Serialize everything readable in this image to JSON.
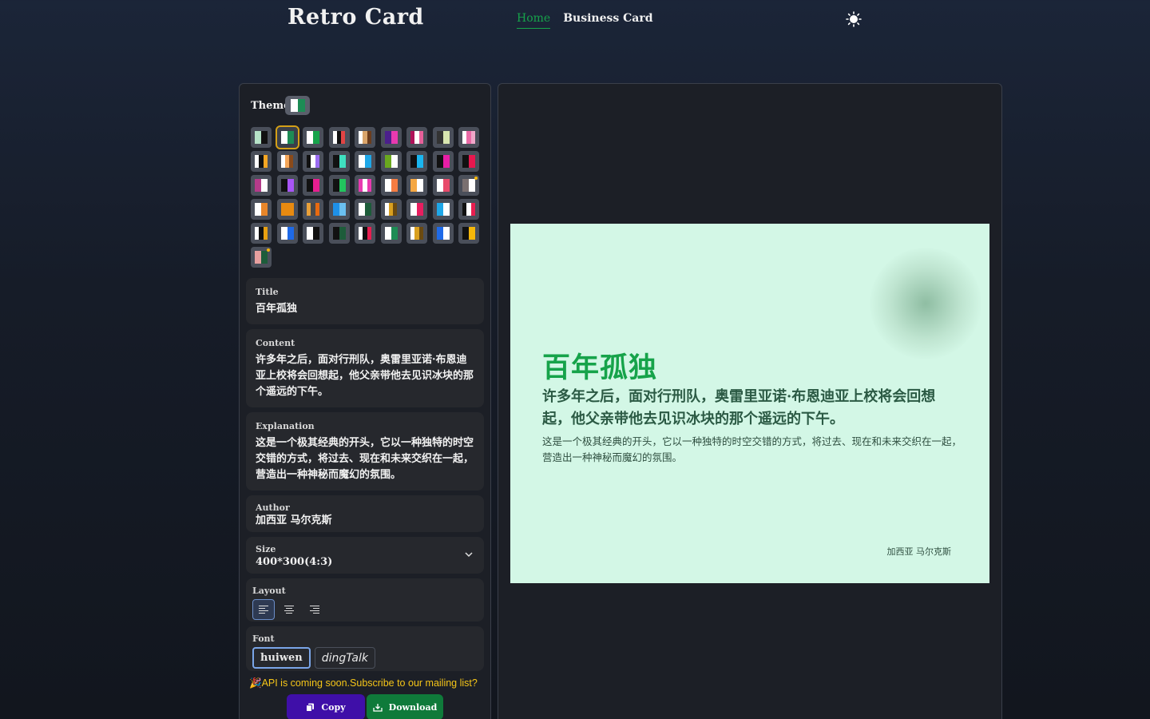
{
  "header": {
    "brand": "Retro Card",
    "nav": [
      {
        "label": "Home",
        "active": true
      },
      {
        "label": "Business Card",
        "active": false
      }
    ]
  },
  "theme": {
    "label": "Theme",
    "current": [
      "#ffffff",
      "#1d8c55"
    ],
    "swatches": [
      [
        "#b6e3c8",
        "#111111"
      ],
      [
        "#ffffff",
        "#1d8c55"
      ],
      [
        "#ffffff",
        "#16a34a"
      ],
      [
        "#ffffff",
        "#111111",
        "#e14444"
      ],
      [
        "#ffffff",
        "#d9a46a",
        "#6b3d1d"
      ],
      [
        "#4b1f8c",
        "#e83ab0"
      ],
      [
        "#b0125a",
        "#ffffff",
        "#e7609a"
      ],
      [
        "#333333",
        "#d8e6b0"
      ],
      [
        "#ffffff",
        "#ea6aa6",
        "#f0a7c9"
      ],
      [
        "#ffffff",
        "#111111",
        "#f5a623"
      ],
      [
        "#ffffff",
        "#f5a75a",
        "#8a4a1a"
      ],
      [
        "#111111",
        "#ffffff",
        "#9b6cf2"
      ],
      [
        "#111111",
        "#3fe0c0"
      ],
      [
        "#ffffff",
        "#1ea7e8"
      ],
      [
        "#6aa81e",
        "#ffffff"
      ],
      [
        "#111111",
        "#1ab6f0"
      ],
      [
        "#111111",
        "#e81ea6"
      ],
      [
        "#111111",
        "#e8174e"
      ],
      [
        "#b43b8a",
        "#ffffff"
      ],
      [
        "#111111",
        "#a855f7"
      ],
      [
        "#111111",
        "#e81e90"
      ],
      [
        "#111111",
        "#22c55e"
      ],
      [
        "#e83ab0",
        "#ffffff",
        "#e83ab0"
      ],
      [
        "#ffffff",
        "#f57c42"
      ],
      [
        "#f5a742",
        "#ffffff"
      ],
      [
        "#ffffff",
        "#e84a6a"
      ],
      [
        "#7a7070",
        "#ffffff"
      ],
      [
        "#ffffff",
        "#e8862a"
      ],
      [
        "#e88a10",
        "#e88a10"
      ],
      [
        "#e8a03a",
        "#4a4a4a",
        "#e86a10"
      ],
      [
        "#1e90e8",
        "#6ac0f0"
      ],
      [
        "#ffffff",
        "#1d5c3a"
      ],
      [
        "#ffffff",
        "#d9a020",
        "#6b4a10"
      ],
      [
        "#ffffff",
        "#e81e60"
      ],
      [
        "#1ea7e8",
        "#ffffff"
      ],
      [
        "#111111",
        "#ffffff",
        "#e81e50"
      ],
      [
        "#ffffff",
        "#111111",
        "#e8a010"
      ],
      [
        "#ffffff",
        "#1e6ae8"
      ],
      [
        "#ffffff",
        "#111111"
      ],
      [
        "#111111",
        "#1d5c3a"
      ],
      [
        "#ffffff",
        "#111111",
        "#e81e50"
      ],
      [
        "#ffffff",
        "#1d8c55"
      ],
      [
        "#ffffff",
        "#d9a020",
        "#6b4a10"
      ],
      [
        "#1e6ae8",
        "#ffffff"
      ],
      [
        "#111111",
        "#f5b70a"
      ],
      [
        "#e8a0a0",
        "#1d5c3a"
      ]
    ]
  },
  "fields": {
    "title": {
      "label": "Title",
      "value": "百年孤独"
    },
    "content": {
      "label": "Content",
      "value": "许多年之后，面对行刑队，奥雷里亚诺·布恩迪亚上校将会回想起，他父亲带他去见识冰块的那个遥远的下午。"
    },
    "explanation": {
      "label": "Explanation",
      "value": "这是一个极其经典的开头，它以一种独特的时空交错的方式，将过去、现在和未来交织在一起，营造出一种神秘而魔幻的氛围。"
    },
    "author": {
      "label": "Author",
      "value": "加西亚 马尔克斯"
    },
    "size": {
      "label": "Size",
      "value": "400*300(4:3)"
    },
    "layout": {
      "label": "Layout"
    },
    "font": {
      "label": "Font",
      "options": [
        {
          "label": "huiwen",
          "active": true
        },
        {
          "label": "dingTalk",
          "active": false
        }
      ]
    }
  },
  "api_note": "🎉API is coming soon.Subscribe to our mailing list?",
  "actions": {
    "copy": "Copy",
    "download": "Download"
  },
  "card": {
    "title": "百年孤独",
    "content": "许多年之后，面对行刑队，奥雷里亚诺·布恩迪亚上校将会回想起，他父亲带他去见识冰块的那个遥远的下午。",
    "explanation": "这是一个极其经典的开头，它以一种独特的时空交错的方式，将过去、现在和未来交织在一起，营造出一种神秘而魔幻的氛围。",
    "author": "加西亚 马尔克斯",
    "background": "#d3f7e6",
    "accent": "#16a34a"
  },
  "icons": {
    "theme_toggle": "sun-icon",
    "size_select": "chevron-down-icon",
    "copy": "copy-icon",
    "download": "download-icon",
    "layout": [
      "align-left-icon",
      "align-center-icon",
      "align-right-icon"
    ]
  }
}
